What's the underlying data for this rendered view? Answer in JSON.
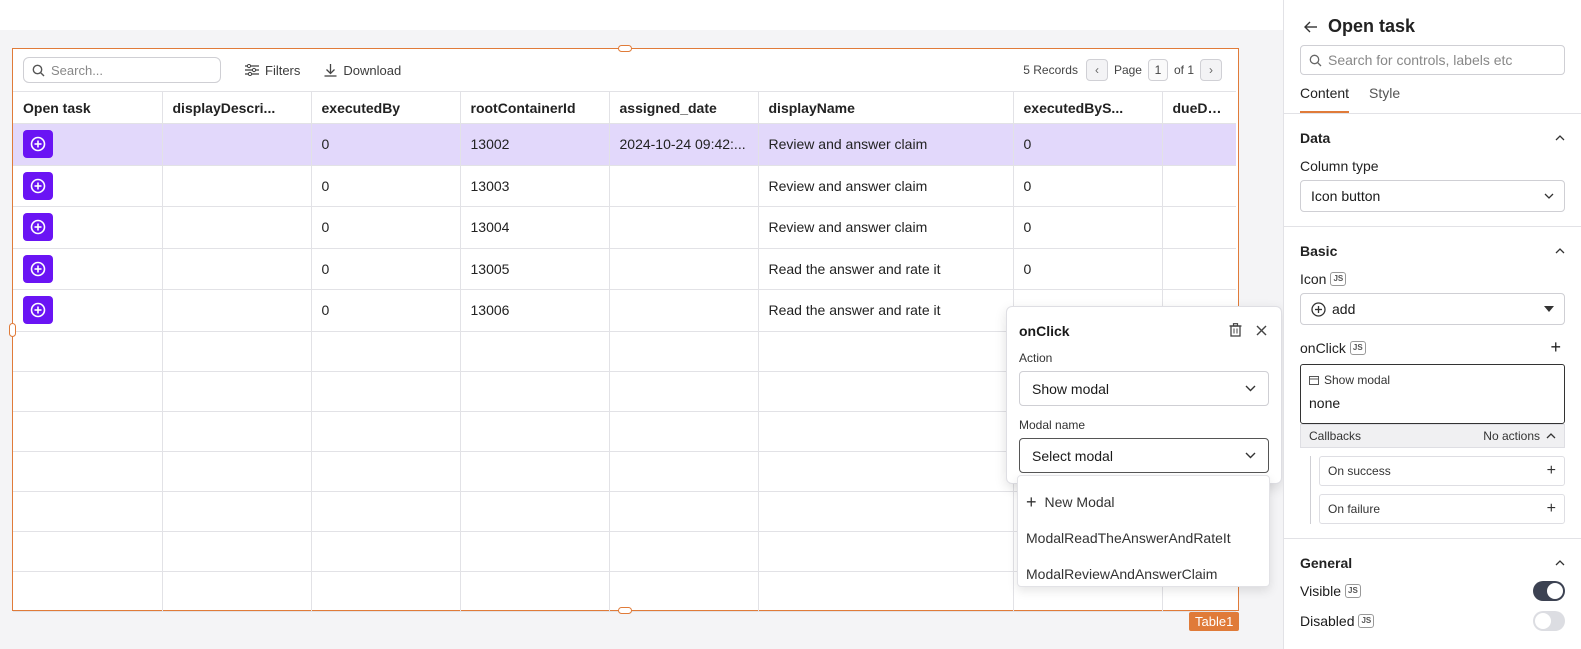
{
  "table": {
    "search_placeholder": "Search...",
    "filters_label": "Filters",
    "download_label": "Download",
    "records": "5 Records",
    "page_label": "Page",
    "page_current": "1",
    "page_of": "of 1",
    "widget_name": "Table1",
    "columns": [
      "Open task",
      "displayDescri...",
      "executedBy",
      "rootContainerId",
      "assigned_date",
      "displayName",
      "executedByS...",
      "dueDate"
    ],
    "rows": [
      {
        "displayDescription": "",
        "executedBy": "0",
        "rootContainerId": "13002",
        "assigned_date": "2024-10-24 09:42:...",
        "displayName": "Review and answer claim",
        "executedBySubstitute": "0",
        "dueDate": ""
      },
      {
        "displayDescription": "",
        "executedBy": "0",
        "rootContainerId": "13003",
        "assigned_date": "",
        "displayName": "Review and answer claim",
        "executedBySubstitute": "0",
        "dueDate": ""
      },
      {
        "displayDescription": "",
        "executedBy": "0",
        "rootContainerId": "13004",
        "assigned_date": "",
        "displayName": "Review and answer claim",
        "executedBySubstitute": "0",
        "dueDate": ""
      },
      {
        "displayDescription": "",
        "executedBy": "0",
        "rootContainerId": "13005",
        "assigned_date": "",
        "displayName": "Read the answer and rate it",
        "executedBySubstitute": "0",
        "dueDate": ""
      },
      {
        "displayDescription": "",
        "executedBy": "0",
        "rootContainerId": "13006",
        "assigned_date": "",
        "displayName": "Read the answer and rate it",
        "executedBySubstitute": "",
        "dueDate": ""
      }
    ],
    "accent": "#6a14f4",
    "selection_color": "#e2d8fb",
    "widget_border": "#e07b39"
  },
  "popup": {
    "title": "onClick",
    "action_label": "Action",
    "action_value": "Show modal",
    "modal_label": "Modal name",
    "modal_value": "Select modal",
    "options": [
      "New Modal",
      "ModalReadTheAnswerAndRateIt",
      "ModalReviewAndAnswerClaim"
    ]
  },
  "panel": {
    "title": "Open task",
    "search_placeholder": "Search for controls, labels etc",
    "tabs": [
      "Content",
      "Style"
    ],
    "data_section": "Data",
    "column_type_label": "Column type",
    "column_type_value": "Icon button",
    "basic_section": "Basic",
    "icon_label": "Icon",
    "icon_value": "add",
    "onclick_label": "onClick",
    "js_badge": "JS",
    "action_name": "Show modal",
    "action_detail": "none",
    "callbacks_label": "Callbacks",
    "callbacks_status": "No actions",
    "on_success": "On success",
    "on_failure": "On failure",
    "general_section": "General",
    "visible_label": "Visible",
    "visible_on": true,
    "disabled_label": "Disabled",
    "disabled_on": false
  }
}
